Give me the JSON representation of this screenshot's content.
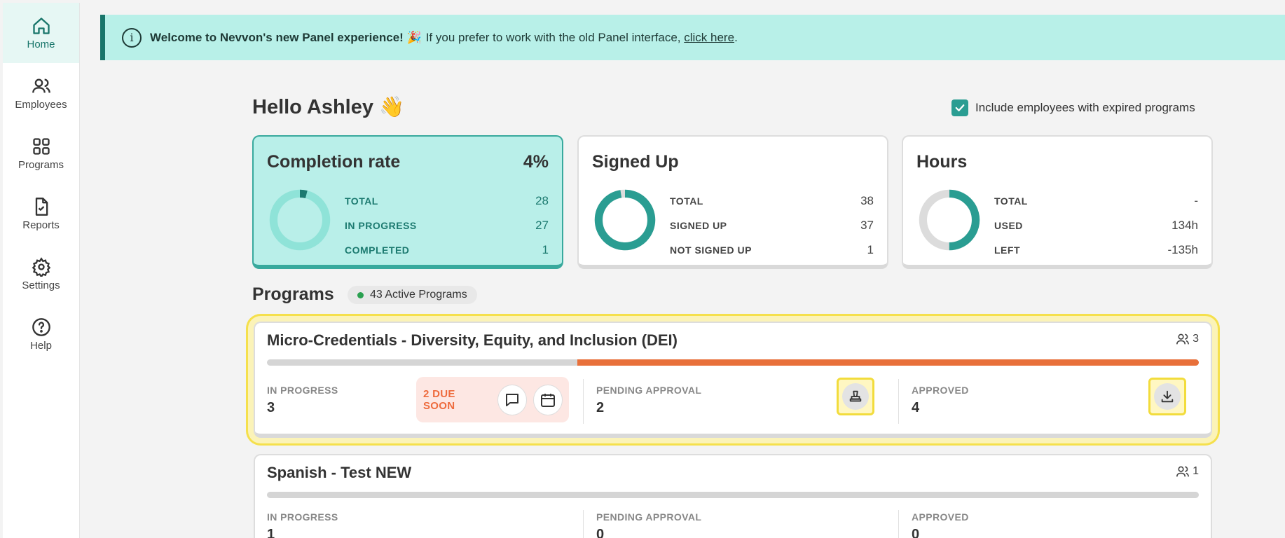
{
  "sidebar": {
    "items": [
      {
        "label": "Home",
        "icon": "home-icon",
        "active": true
      },
      {
        "label": "Employees",
        "icon": "users-icon"
      },
      {
        "label": "Programs",
        "icon": "grid-icon"
      },
      {
        "label": "Reports",
        "icon": "report-icon"
      },
      {
        "label": "Settings",
        "icon": "gear-icon"
      },
      {
        "label": "Help",
        "icon": "help-icon"
      }
    ]
  },
  "banner": {
    "bold": "Welcome to Nevvon's new Panel experience! 🎉",
    "text": "If you prefer to work with the old Panel interface,",
    "link": "click here",
    "suffix": "."
  },
  "greeting": "Hello Ashley 👋",
  "include_expired": {
    "label": "Include employees with expired programs",
    "checked": true
  },
  "cards": {
    "completion": {
      "title": "Completion rate",
      "percent": "4%",
      "donut_fraction": 0.04,
      "rows": [
        {
          "label": "TOTAL",
          "value": "28"
        },
        {
          "label": "IN PROGRESS",
          "value": "27"
        },
        {
          "label": "COMPLETED",
          "value": "1"
        }
      ]
    },
    "signed_up": {
      "title": "Signed Up",
      "donut_fraction": 0.974,
      "rows": [
        {
          "label": "TOTAL",
          "value": "38"
        },
        {
          "label": "SIGNED UP",
          "value": "37"
        },
        {
          "label": "NOT SIGNED UP",
          "value": "1"
        }
      ]
    },
    "hours": {
      "title": "Hours",
      "donut_fraction": 0.5,
      "rows": [
        {
          "label": "TOTAL",
          "value": "-"
        },
        {
          "label": "USED",
          "value": "134h"
        },
        {
          "label": "LEFT",
          "value": "-135h"
        }
      ]
    }
  },
  "programs": {
    "title": "Programs",
    "active_label": "43 Active Programs",
    "list": [
      {
        "title": "Micro-Credentials - Diversity, Equity, and Inclusion (DEI)",
        "count": "3",
        "progress_fraction": 0.667,
        "in_progress_label": "IN PROGRESS",
        "in_progress": "3",
        "due_soon": "2 DUE SOON",
        "pending_label": "PENDING APPROVAL",
        "pending": "2",
        "approved_label": "APPROVED",
        "approved": "4"
      },
      {
        "title": "Spanish - Test NEW",
        "count": "1",
        "progress_fraction": 0,
        "in_progress_label": "IN PROGRESS",
        "in_progress": "1",
        "pending_label": "PENDING APPROVAL",
        "pending": "0",
        "approved_label": "APPROVED",
        "approved": "0"
      }
    ]
  },
  "colors": {
    "brand": "#18756a",
    "accent_teal": "#2a9d92",
    "orange": "#e8703a",
    "highlight": "#f5e04c"
  }
}
